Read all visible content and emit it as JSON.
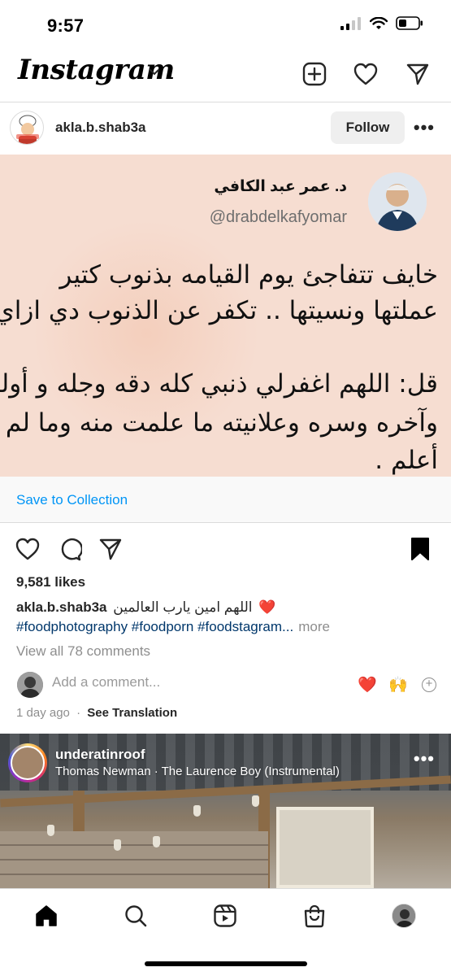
{
  "status_bar": {
    "time": "9:57"
  },
  "header": {
    "logo": "Instagram",
    "icons": [
      "chevron-down-icon",
      "new-post-icon",
      "activity-heart-icon",
      "direct-message-icon"
    ]
  },
  "post": {
    "username": "akla.b.shab3a",
    "follow_label": "Follow",
    "image": {
      "tweet_name": "د. عمر عبد الكافي",
      "tweet_handle": "@drabdelkafyomar",
      "lines": [
        "خايف تتفاجئ يوم القيامه بذنوب كتير",
        "عملتها ونسيتها .. تكفر عن الذنوب دي ازاي؟",
        "قل: اللهم اغفرلي ذنبي كله دقه وجله و أوله",
        "وآخره وسره وعلانيته ما علمت منه وما لم",
        "أعلم ."
      ]
    },
    "save_to_collection": "Save to Collection",
    "likes": "9,581 likes",
    "caption_user": "akla.b.shab3a",
    "caption_text": "اللهم امين يارب العالمين",
    "caption_emoji": "❤️",
    "hashtags": "#foodphotography #foodporn #foodstagram...",
    "more_label": "more",
    "view_comments": "View all 78 comments",
    "comment_placeholder": "Add a comment...",
    "quick_emojis": [
      "❤️",
      "🙌"
    ],
    "time_ago": "1 day ago",
    "separator": "·",
    "see_translation": "See Translation"
  },
  "next_post": {
    "username": "underatinroof",
    "audio": "Thomas Newman · The Laurence Boy (Instrumental)"
  },
  "bottom_nav": [
    "home-icon",
    "search-icon",
    "reels-icon",
    "shop-icon",
    "profile-avatar"
  ]
}
